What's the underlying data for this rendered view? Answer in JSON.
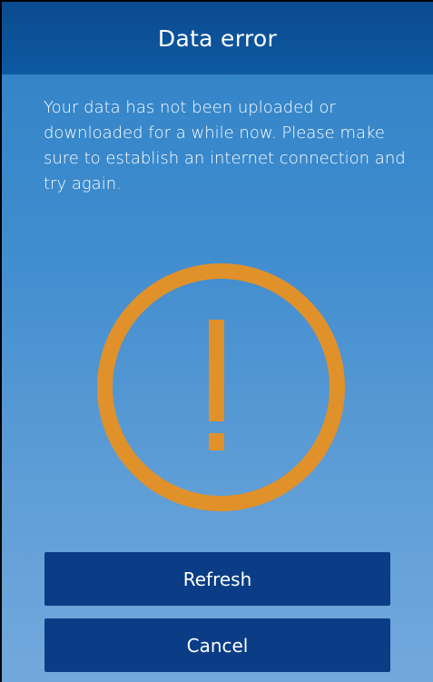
{
  "header": {
    "title": "Data error"
  },
  "message": "Your data has not been uploaded or downloaded for a while now. Please make sure to establish an internet connection and try again.",
  "icon": {
    "name": "warning-icon",
    "color": "#e0912a"
  },
  "buttons": {
    "refresh_label": "Refresh",
    "cancel_label": "Cancel"
  }
}
